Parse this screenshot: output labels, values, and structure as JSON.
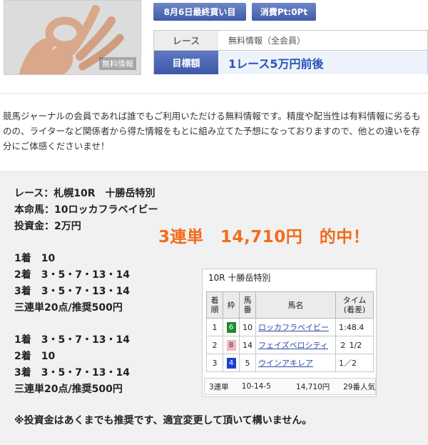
{
  "header": {
    "thumb_label": "無料情報",
    "deadline_pill": "8月6日最終買い目",
    "cost_pill": "消費Pt:0Pt",
    "race_label": "レース",
    "race_value": "無料情報（全会員）",
    "target_label": "目標額",
    "target_value": "1レース5万円前後"
  },
  "intro": "競馬ジャーナルの会員であれば誰でもご利用いただける無料情報です。精度や配当性は有料情報に劣るものの、ライターなど関係者から得た情報をもとに組み立てた予想になっておりますので、他との違いを存分にご体感くださいませ！",
  "pick": {
    "race": "レース：札幌10R　十勝岳特別",
    "favorite": "本命馬：10ロッカフラベイビー",
    "investment": "投資金：2万円",
    "hit_text": "3連単　14,710円　的中！",
    "set1": {
      "first": "1着　10",
      "second": "2着　3・5・7・13・14",
      "third": "3着　3・5・7・13・14",
      "summary": "三連単20点/推奨500円"
    },
    "set2": {
      "first": "1着　3・5・7・13・14",
      "second": "2着　10",
      "third": "3着　3・5・7・13・14",
      "summary": "三連単20点/推奨500円"
    },
    "note": "※投資金はあくまでも推奨です、適宜変更して頂いて構いません。"
  },
  "result": {
    "title": "10R 十勝岳特別",
    "headers": {
      "rank": "着\n順",
      "gate": "枠",
      "num": "馬\n番",
      "name": "馬名",
      "time": "タイム\n(着差)"
    },
    "rows": [
      {
        "rank": "1",
        "gate": "6",
        "gate_bg": "#1f8a2e",
        "gate_fg": "#ffffff",
        "num": "10",
        "name": "ロッカフラベイビー",
        "time": "1:48.4"
      },
      {
        "rank": "2",
        "gate": "8",
        "gate_bg": "#f4b6c2",
        "gate_fg": "#333333",
        "num": "14",
        "name": "フェイズベロシティ",
        "time": "２ 1/2"
      },
      {
        "rank": "3",
        "gate": "4",
        "gate_bg": "#1d3fd0",
        "gate_fg": "#ffffff",
        "num": "5",
        "name": "ウインアキレア",
        "time": "1／2"
      }
    ],
    "payout": {
      "type": "3連単",
      "combo": "10-14-5",
      "amount": "14,710円",
      "popularity": "29番人気"
    }
  }
}
